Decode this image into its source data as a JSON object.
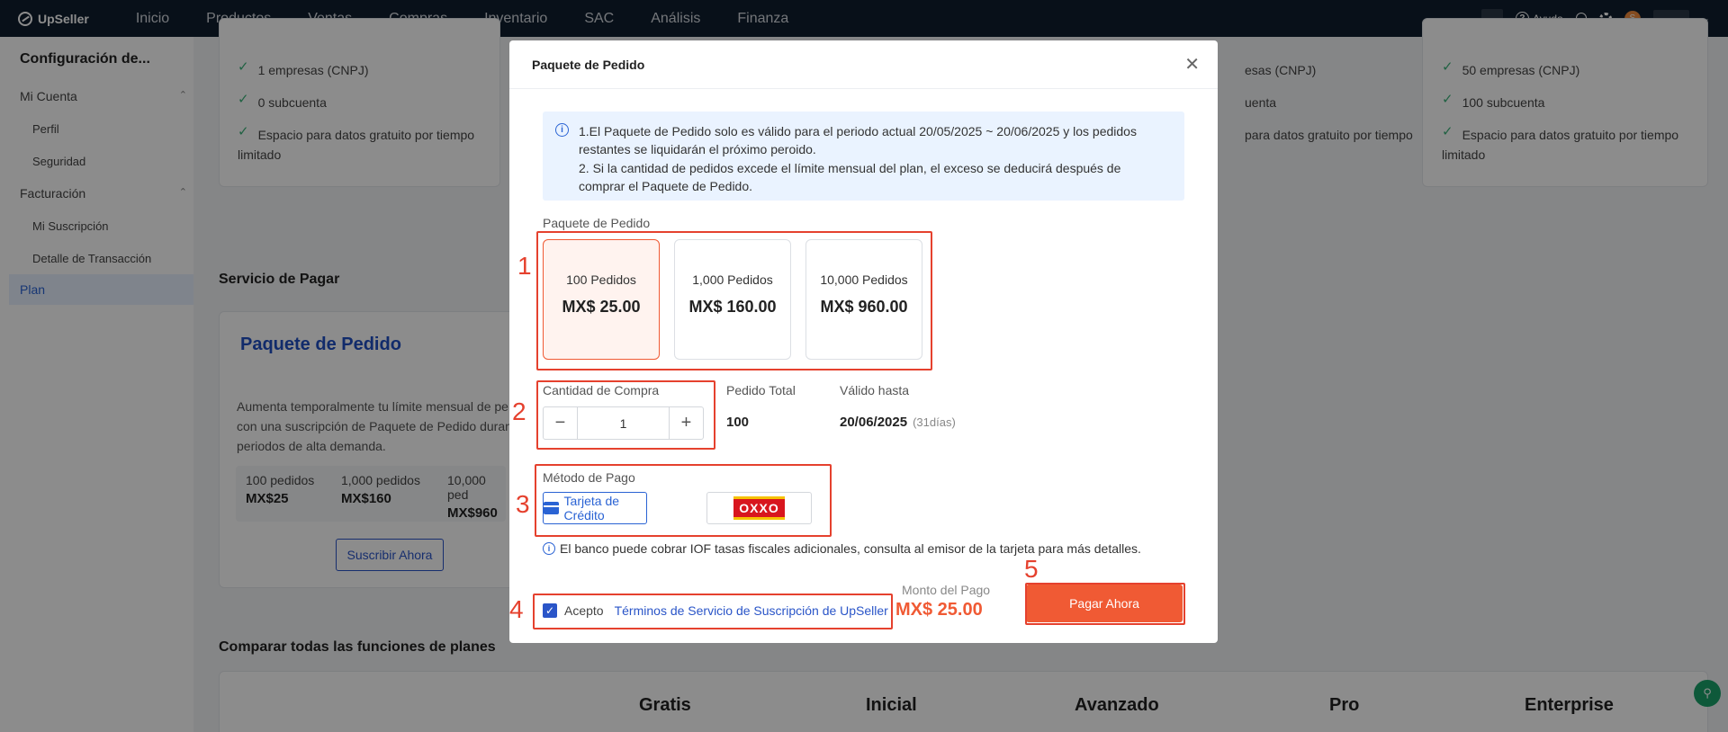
{
  "nav": {
    "brand": "UpSeller",
    "items": [
      "Inicio",
      "Productos",
      "Ventas",
      "Compras",
      "Inventario",
      "SAC",
      "Análisis",
      "Finanza"
    ],
    "help": "Ayuda"
  },
  "sidebar": {
    "title": "Configuración de...",
    "account": "Mi Cuenta",
    "profile": "Perfil",
    "security": "Seguridad",
    "billing": "Facturación",
    "subscription": "Mi Suscripción",
    "transactions": "Detalle de Transacción",
    "plan": "Plan"
  },
  "background": {
    "left_card": {
      "f1": "1 empresas (CNPJ)",
      "f2": "0 subcuenta",
      "f3a": "Espacio para datos gratuito por tiempo",
      "f3b": "limitado"
    },
    "middle_card": {
      "f1": "esas (CNPJ)",
      "f2": "uenta",
      "f3": "para datos gratuito por tiempo"
    },
    "right_card": {
      "f1": "50 empresas (CNPJ)",
      "f2": "100 subcuenta",
      "f3a": "Espacio para datos gratuito por tiempo",
      "f3b": "limitado"
    },
    "service_title": "Servicio de Pagar",
    "package_title": "Paquete de Pedido",
    "package_desc_1": "Aumenta temporalmente tu límite mensual de pe",
    "package_desc_2": "con una suscripción de Paquete de Pedido duran",
    "package_desc_3": "periodos de alta demanda.",
    "tiers": [
      {
        "name": "100 pedidos",
        "price": "MX$25"
      },
      {
        "name": "1,000 pedidos",
        "price": "MX$160"
      },
      {
        "name": "10,000 ped",
        "price": "MX$960"
      }
    ],
    "subscribe_button": "Suscribir Ahora",
    "compare_title": "Comparar todas las funciones de planes",
    "plan_columns": [
      "Gratis",
      "Inicial",
      "Avanzado",
      "Pro",
      "Enterprise"
    ]
  },
  "modal": {
    "title": "Paquete de Pedido",
    "notice_1a": "1.El Paquete de Pedido solo es válido para el periodo actual 20/05/2025 ~ 20/06/2025 y los pedidos",
    "notice_1b": "restantes se liquidarán el próximo peroido.",
    "notice_2a": "2. Si la cantidad de pedidos excede el límite mensual del plan, el exceso se deducirá después de",
    "notice_2b": "comprar el Paquete de Pedido.",
    "package_label": "Paquete de Pedido",
    "packages": [
      {
        "count": "100 Pedidos",
        "price": "MX$ 25.00"
      },
      {
        "count": "1,000 Pedidos",
        "price": "MX$ 160.00"
      },
      {
        "count": "10,000 Pedidos",
        "price": "MX$ 960.00"
      }
    ],
    "quantity_label": "Cantidad de Compra",
    "quantity_value": "1",
    "total_label": "Pedido Total",
    "total_value": "100",
    "valid_label": "Válido hasta",
    "valid_value": "20/06/2025",
    "valid_days": "(31días)",
    "method_label": "Método de Pago",
    "method_card": "Tarjeta de Crédito",
    "method_oxxo": "OXXO",
    "iof_note": "El banco puede cobrar IOF tasas fiscales adicionales, consulta al emisor de la tarjeta para más detalles.",
    "accept": "Acepto",
    "terms": "Términos de Servicio de Suscripción de UpSeller",
    "amount_label": "Monto del Pago",
    "amount_value": "MX$ 25.00",
    "pay_button": "Pagar Ahora"
  },
  "annotations": [
    "1",
    "2",
    "3",
    "4",
    "5"
  ],
  "colors": {
    "accent": "#f05a34",
    "primary": "#2a55c8",
    "annotation": "#e5412e",
    "nav_bg": "#0f1e2e"
  }
}
